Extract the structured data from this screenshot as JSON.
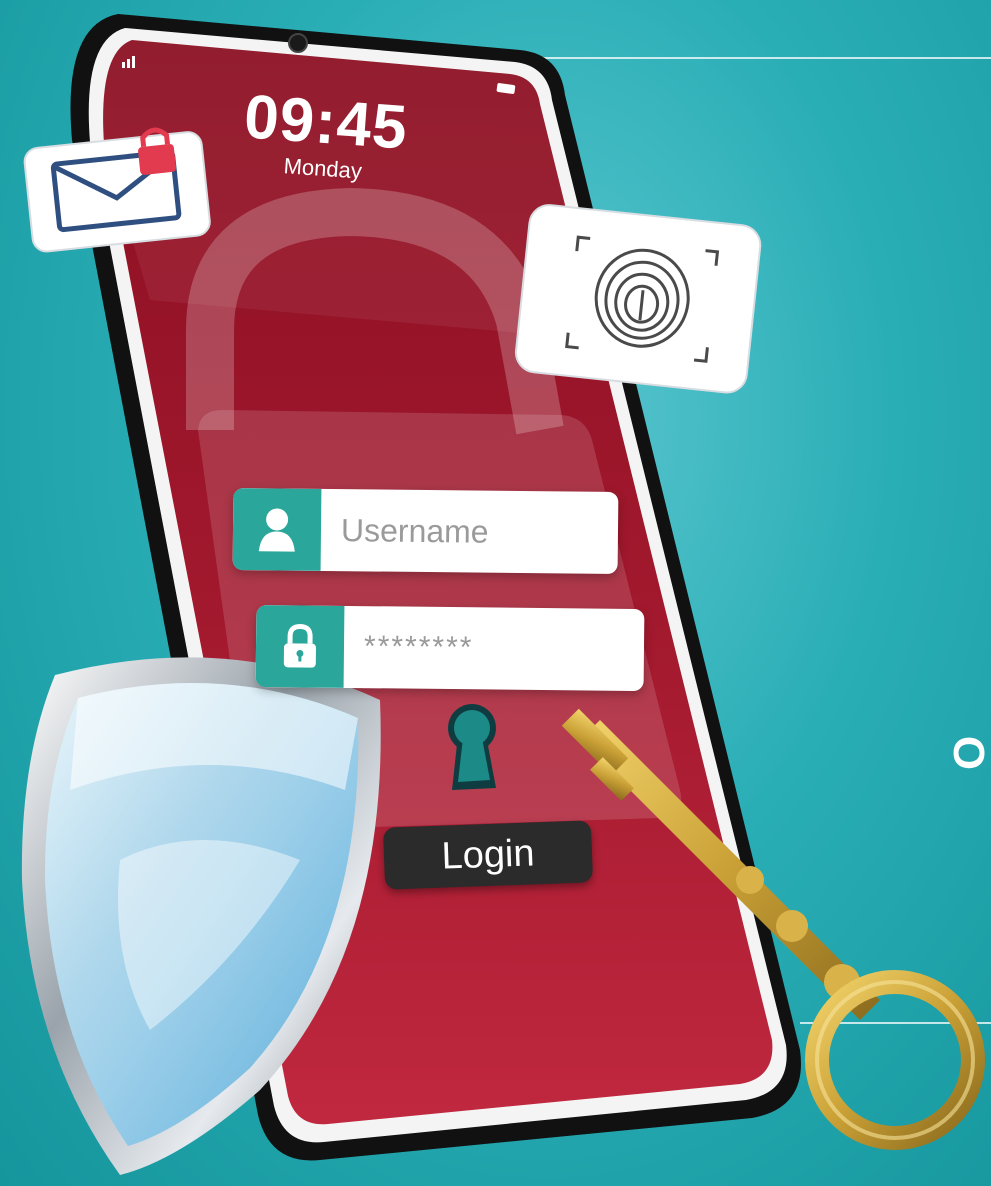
{
  "lock_screen": {
    "time": "09:45",
    "day": "Monday"
  },
  "login_form": {
    "username_placeholder": "Username",
    "password_mask": "********",
    "login_label": "Login"
  },
  "side_text": "O",
  "icons": {
    "mail": "locked-mail-icon",
    "fingerprint": "fingerprint-icon",
    "padlock": "padlock-icon",
    "keyhole": "keyhole-icon",
    "user": "user-icon",
    "lock": "lock-icon",
    "shield": "shield-icon",
    "key": "key-icon"
  },
  "colors": {
    "background": "#2aaeb6",
    "screen": "#a3192e",
    "accent": "#2aa69a",
    "button": "#2b2b2b",
    "key_gold": "#c9a036"
  }
}
